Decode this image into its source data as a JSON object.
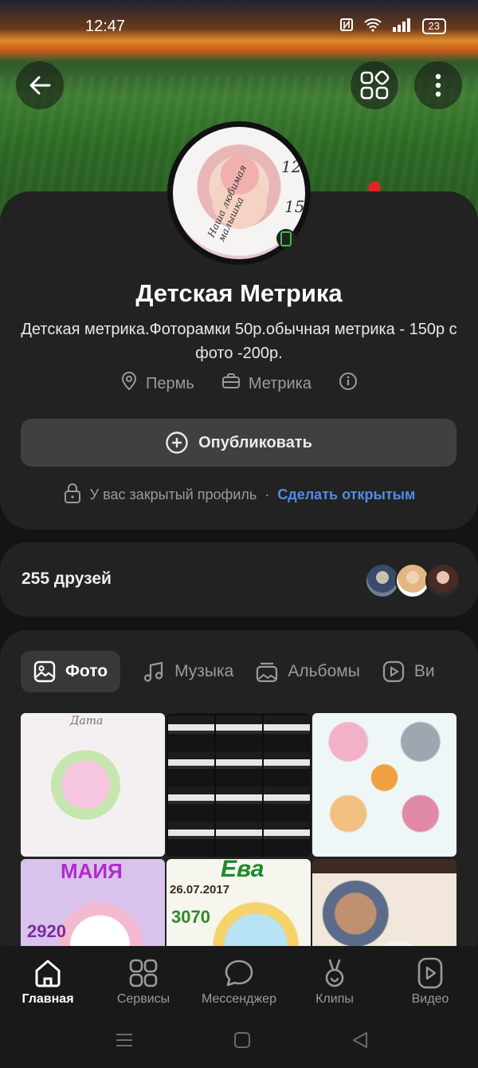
{
  "status_bar": {
    "time": "12:47",
    "battery": "23"
  },
  "header": {
    "back_icon": "arrow-left-icon",
    "services_icon": "grid-icon",
    "menu_icon": "more-vertical-icon"
  },
  "profile": {
    "name": "Детская Метрика",
    "description": "Детская метрика.Фоторамки 50р.обычная метрика - 150р с фото -200р.",
    "city": "Пермь",
    "work": "Метрика",
    "avatar_text": {
      "arc": "Наша любимая малышка",
      "num1": "12.",
      "num2": "15"
    }
  },
  "actions": {
    "publish_label": "Опубликовать",
    "closed_profile_text": "У вас закрытый профиль",
    "separator": "·",
    "make_open_label": "Сделать открытым"
  },
  "friends": {
    "count_label": "255 друзей"
  },
  "tabs": [
    {
      "label": "Фото",
      "active": true
    },
    {
      "label": "Музыка",
      "active": false
    },
    {
      "label": "Альбомы",
      "active": false
    },
    {
      "label": "Ви",
      "active": false
    }
  ],
  "photos": {
    "items": [
      {
        "caption": "Дата",
        "theme": "baby-fairy"
      },
      {
        "caption": "",
        "theme": "app-screenshots"
      },
      {
        "caption": "",
        "theme": "animal-stickers"
      },
      {
        "caption": "МАИЯ",
        "theme": "pink-kitten",
        "extra": "2920"
      },
      {
        "caption": "Ева",
        "theme": "unicorn",
        "extra": "26.07.2017",
        "extra2": "3070"
      },
      {
        "caption": "",
        "theme": "coffee-collage"
      }
    ]
  },
  "bottom_nav": [
    {
      "label": "Главная",
      "active": true
    },
    {
      "label": "Сервисы",
      "active": false
    },
    {
      "label": "Мессенджер",
      "active": false
    },
    {
      "label": "Клипы",
      "active": false
    },
    {
      "label": "Видео",
      "active": false
    }
  ],
  "colors": {
    "accent_link": "#4f8de8",
    "online": "#3cbf4a",
    "background": "#141414",
    "card": "#222222"
  }
}
